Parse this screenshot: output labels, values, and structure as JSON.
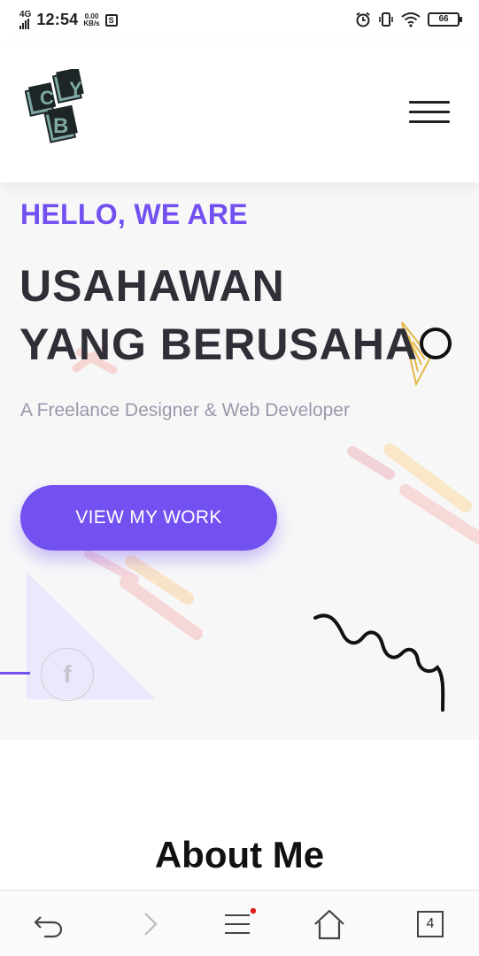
{
  "status_bar": {
    "network": "4G",
    "time": "12:54",
    "speed_value": "0.00",
    "speed_unit": "KB/s",
    "app_icon_letter": "S",
    "battery": "66"
  },
  "header": {
    "logo_letters": [
      "C",
      "Y",
      "B"
    ],
    "menu_icon": "hamburger-icon"
  },
  "hero": {
    "greeting": "HELLO, WE ARE",
    "headline_line1": "USAHAWAN",
    "headline_line2": "YANG BERUSAHA",
    "tagline": "A Freelance Designer & Web Developer",
    "cta_label": "VIEW MY WORK",
    "social_icon_letter": "f"
  },
  "about": {
    "title": "About Me"
  },
  "browser_nav": {
    "tab_count": "4",
    "icons": [
      "back-icon",
      "forward-icon",
      "menu-icon",
      "home-icon",
      "tabs-icon"
    ]
  },
  "colors": {
    "accent": "#7350f0",
    "headline": "#2f2f38",
    "tagline": "#9a98aa",
    "hero_bg": "#f7f7f8"
  }
}
